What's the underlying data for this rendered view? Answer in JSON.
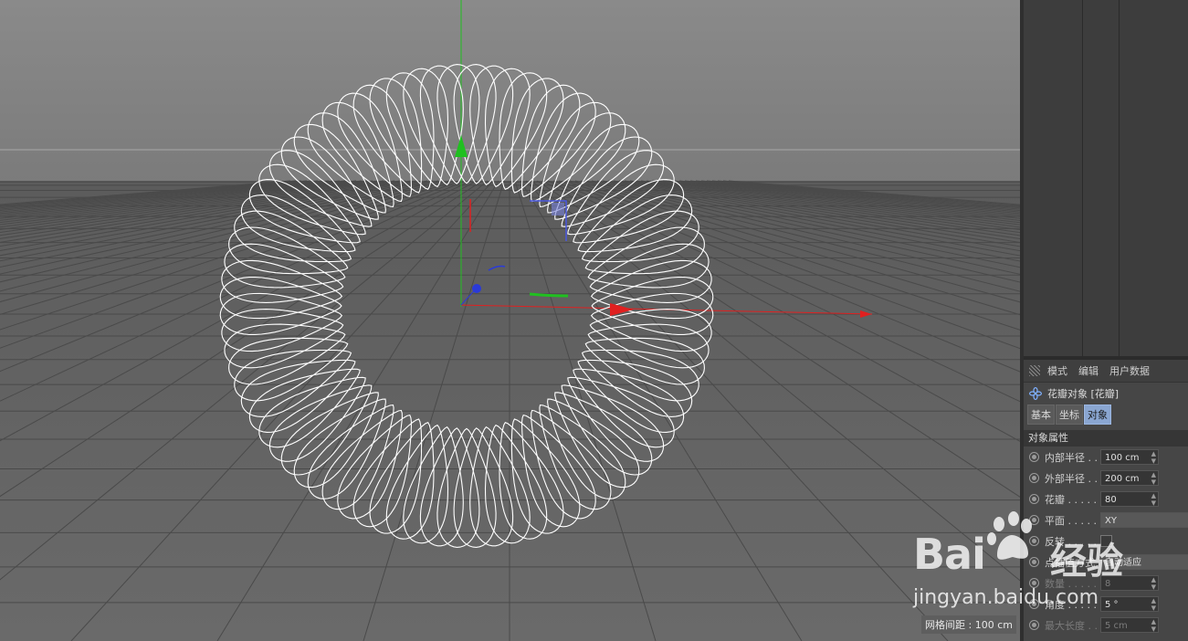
{
  "viewport": {
    "grid_spacing_label": "网格间距 : 100 cm"
  },
  "attributes": {
    "menu": [
      "模式",
      "编辑",
      "用户数据"
    ],
    "object_title": "花瓣对象 [花瓣]",
    "tabs": [
      "基本",
      "坐标",
      "对象"
    ],
    "active_tab": "对象",
    "section_title": "对象属性",
    "props": {
      "inner_radius": {
        "label": "内部半径 . .",
        "value": "100 cm"
      },
      "outer_radius": {
        "label": "外部半径 . .",
        "value": "200 cm"
      },
      "petals": {
        "label": "花瓣 . . . . .",
        "value": "80"
      },
      "plane": {
        "label": "平面 . . . . .",
        "value": "XY"
      },
      "reverse": {
        "label": "反转 . . . . ."
      },
      "interpolation": {
        "label": "点插值方式",
        "value": "自动适应"
      },
      "count": {
        "label": "数量 . . . . .",
        "value": "8"
      },
      "angle": {
        "label": "角度 . . . . .",
        "value": "5 °"
      },
      "max_length": {
        "label": "最大长度 . .",
        "value": "5 cm"
      }
    }
  },
  "watermark": {
    "brand": "Bai",
    "brand_cn": "经验",
    "url": "jingyan.baidu.com"
  },
  "colors": {
    "axis_x": "#e02020",
    "axis_y": "#20c020",
    "axis_z": "#2a3ad8",
    "curve": "#ffffff",
    "active_tab": "#8aa6d1"
  }
}
